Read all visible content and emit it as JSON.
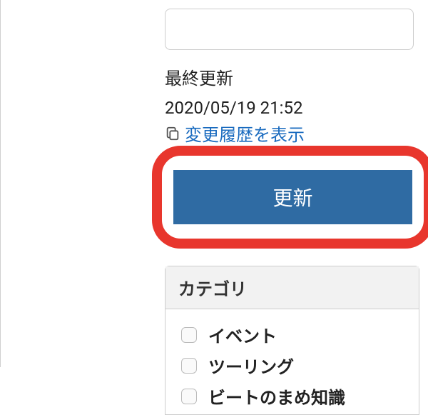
{
  "lastUpdate": {
    "label": "最終更新",
    "timestamp": "2020/05/19 21:52",
    "historyLink": "変更履歴を表示"
  },
  "updateButton": {
    "label": "更新"
  },
  "categories": {
    "header": "カテゴリ",
    "items": [
      {
        "label": "イベント"
      },
      {
        "label": "ツーリング"
      },
      {
        "label": "ビートのまめ知識"
      }
    ]
  }
}
